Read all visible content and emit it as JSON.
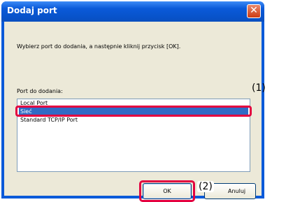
{
  "dialog": {
    "title": "Dodaj port",
    "close_glyph": "✕",
    "instruction": "Wybierz port do dodania, a następnie kliknij przycisk [OK].",
    "port_label": "Port do dodania:",
    "port_options": [
      "Local Port",
      "Sieć",
      "Standard TCP/IP Port"
    ],
    "selected_index": 1,
    "ok_label": "OK",
    "cancel_label": "Anuluj"
  },
  "annotations": {
    "callout_1": "(1)",
    "callout_2": "(2)"
  },
  "colors": {
    "title_bar": "#0a5ad9",
    "selection": "#316ac5",
    "highlight_frame": "#e3003f"
  }
}
